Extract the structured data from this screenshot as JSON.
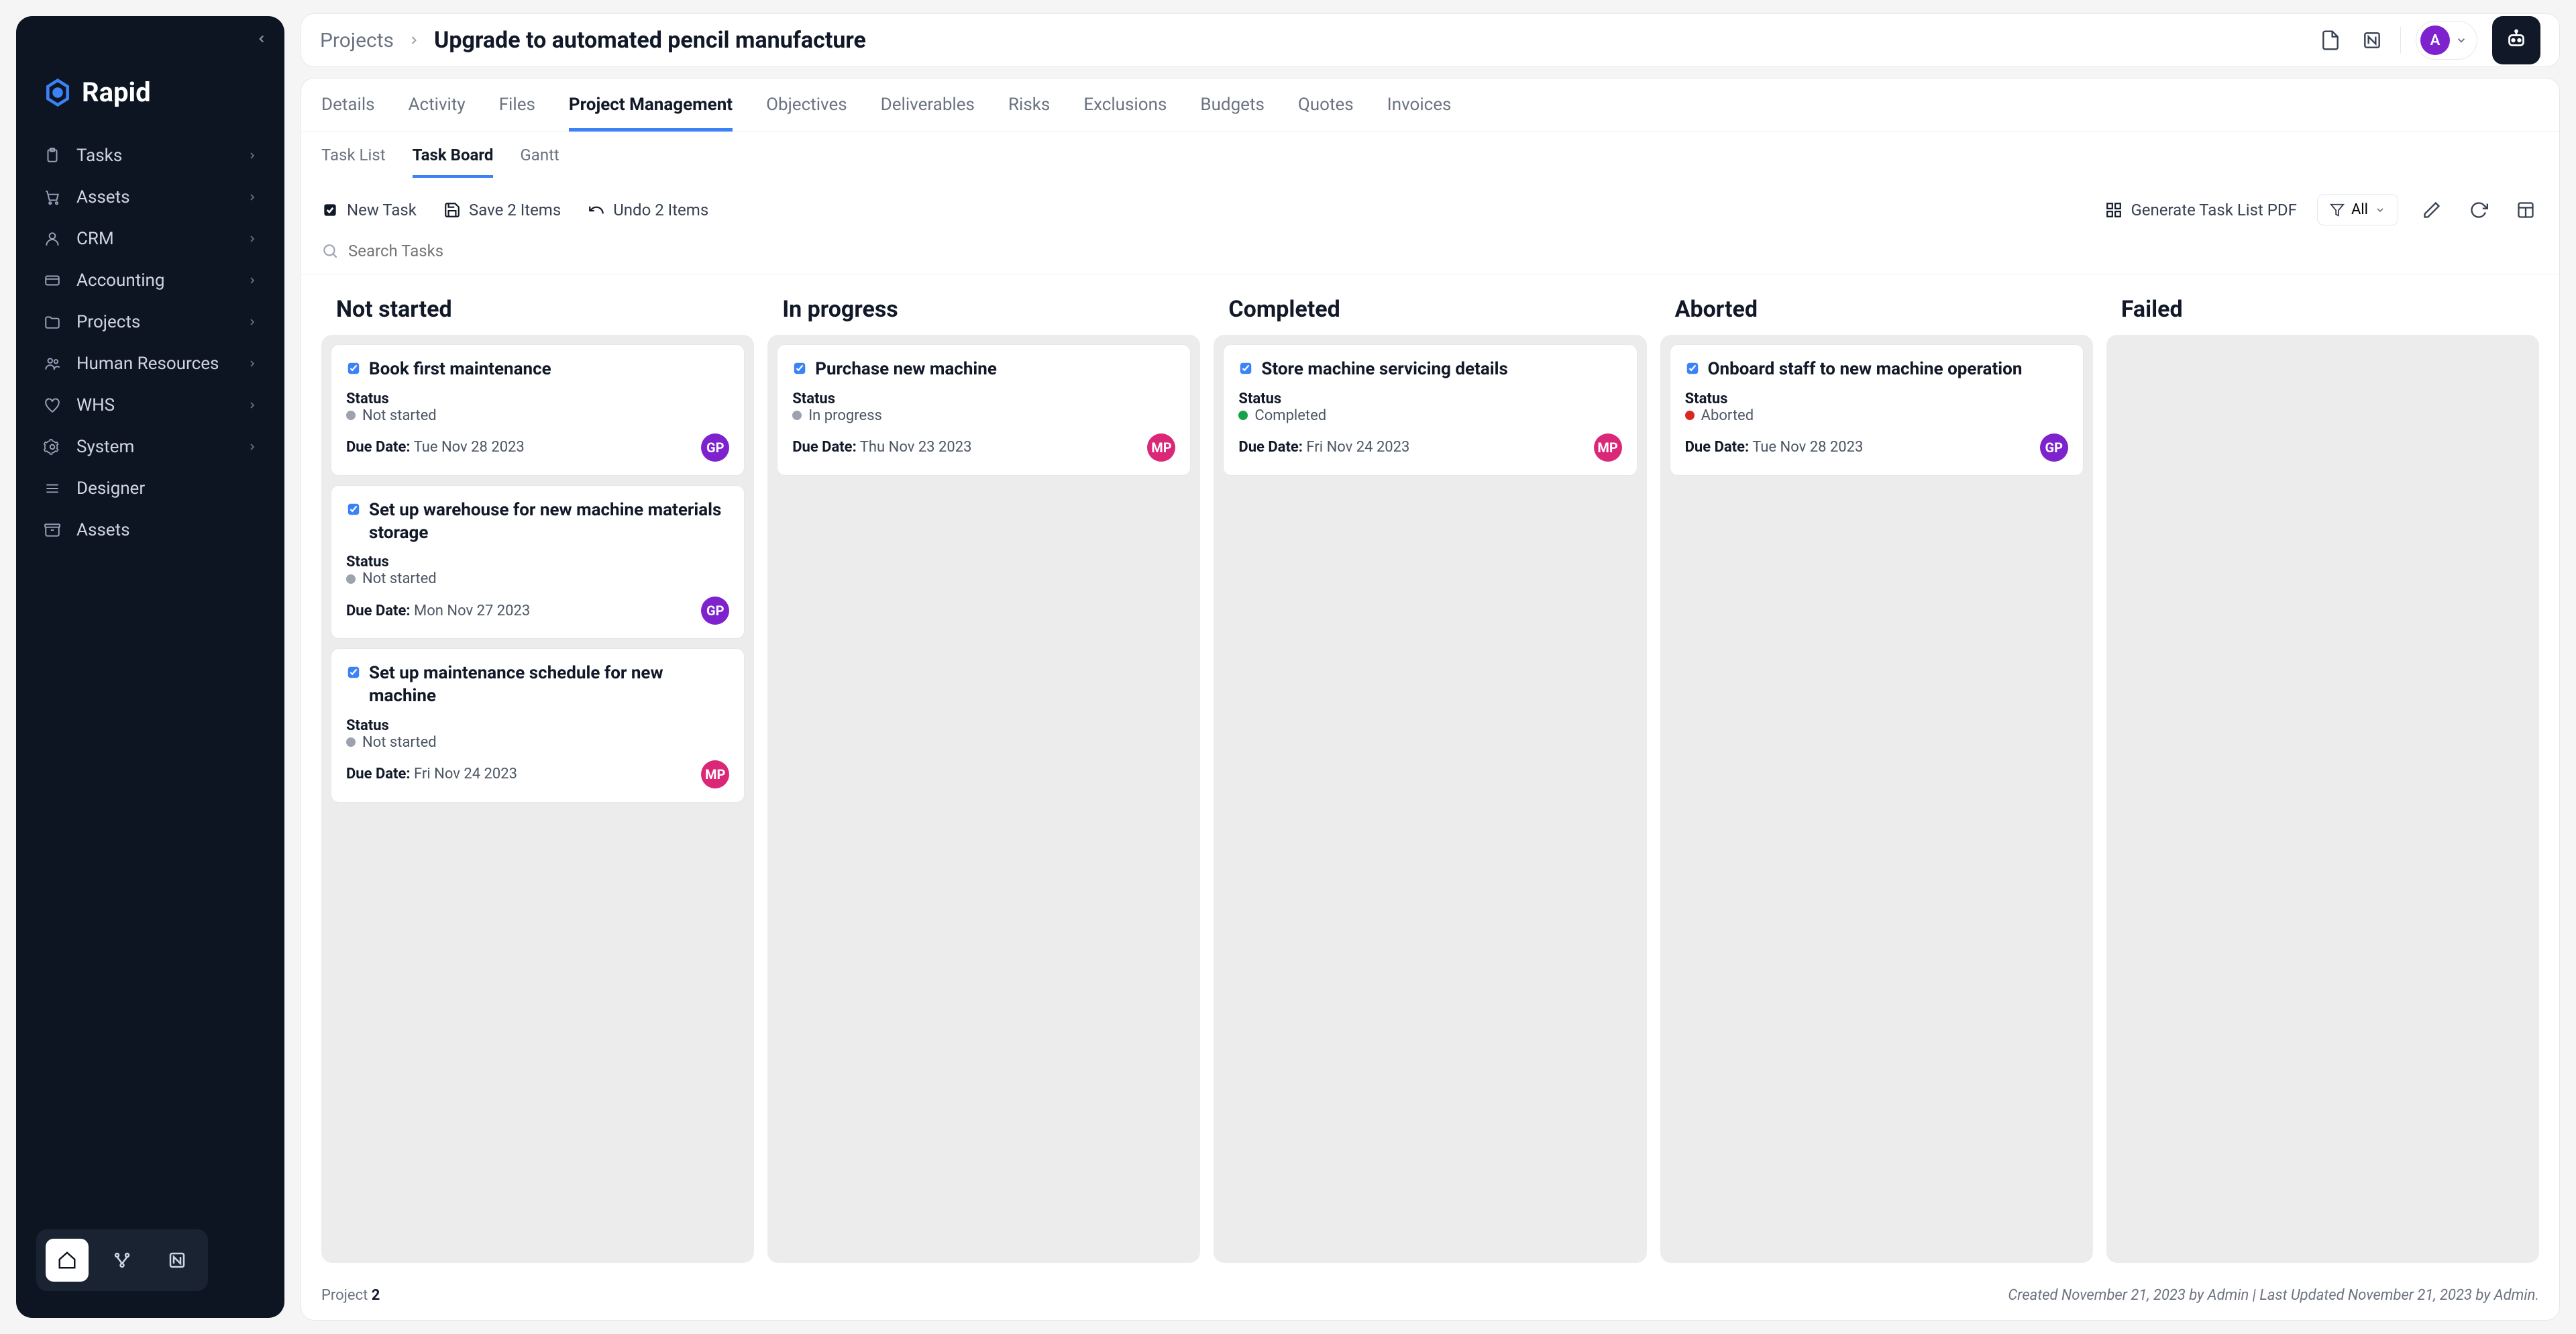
{
  "brand": "Rapid",
  "sidebar": {
    "items": [
      {
        "label": "Tasks",
        "icon": "clipboard"
      },
      {
        "label": "Assets",
        "icon": "cart"
      },
      {
        "label": "CRM",
        "icon": "user"
      },
      {
        "label": "Accounting",
        "icon": "card"
      },
      {
        "label": "Projects",
        "icon": "folder"
      },
      {
        "label": "Human Resources",
        "icon": "team"
      },
      {
        "label": "WHS",
        "icon": "heart"
      },
      {
        "label": "System",
        "icon": "gear"
      },
      {
        "label": "Designer",
        "icon": "list"
      },
      {
        "label": "Assets",
        "icon": "box"
      }
    ]
  },
  "breadcrumb": {
    "root": "Projects",
    "title": "Upgrade to automated pencil manufacture"
  },
  "user_initial": "A",
  "tabs_primary": [
    "Details",
    "Activity",
    "Files",
    "Project Management",
    "Objectives",
    "Deliverables",
    "Risks",
    "Exclusions",
    "Budgets",
    "Quotes",
    "Invoices"
  ],
  "tabs_primary_active": "Project Management",
  "tabs_secondary": [
    "Task List",
    "Task Board",
    "Gantt"
  ],
  "tabs_secondary_active": "Task Board",
  "toolbar": {
    "new_task": "New Task",
    "save": "Save 2 Items",
    "undo": "Undo 2 Items",
    "generate_pdf": "Generate Task List PDF",
    "filter_label": "All"
  },
  "search_placeholder": "Search Tasks",
  "board": {
    "columns": [
      {
        "title": "Not started",
        "cards": [
          {
            "title": "Book first maintenance",
            "status_label": "Status",
            "status": "Not started",
            "dot": "grey",
            "due_label": "Due Date:",
            "due": "Tue Nov 28 2023",
            "assignee": "GP",
            "assignee_class": "gp"
          },
          {
            "title": "Set up warehouse for new machine materials storage",
            "status_label": "Status",
            "status": "Not started",
            "dot": "grey",
            "due_label": "Due Date:",
            "due": "Mon Nov 27 2023",
            "assignee": "GP",
            "assignee_class": "gp"
          },
          {
            "title": "Set up maintenance schedule for new machine",
            "status_label": "Status",
            "status": "Not started",
            "dot": "grey",
            "due_label": "Due Date:",
            "due": "Fri Nov 24 2023",
            "assignee": "MP",
            "assignee_class": "mp"
          }
        ]
      },
      {
        "title": "In progress",
        "cards": [
          {
            "title": "Purchase new machine",
            "status_label": "Status",
            "status": "In progress",
            "dot": "blue",
            "due_label": "Due Date:",
            "due": "Thu Nov 23 2023",
            "assignee": "MP",
            "assignee_class": "mp"
          }
        ]
      },
      {
        "title": "Completed",
        "cards": [
          {
            "title": "Store machine servicing details",
            "status_label": "Status",
            "status": "Completed",
            "dot": "green",
            "due_label": "Due Date:",
            "due": "Fri Nov 24 2023",
            "assignee": "MP",
            "assignee_class": "mp"
          }
        ]
      },
      {
        "title": "Aborted",
        "cards": [
          {
            "title": "Onboard staff to new machine operation",
            "status_label": "Status",
            "status": "Aborted",
            "dot": "red",
            "due_label": "Due Date:",
            "due": "Tue Nov 28 2023",
            "assignee": "GP",
            "assignee_class": "gp"
          }
        ]
      },
      {
        "title": "Failed",
        "cards": []
      }
    ]
  },
  "footer": {
    "left_label": "Project",
    "left_value": "2",
    "right": "Created November 21, 2023 by Admin | Last Updated November 21, 2023 by Admin."
  }
}
